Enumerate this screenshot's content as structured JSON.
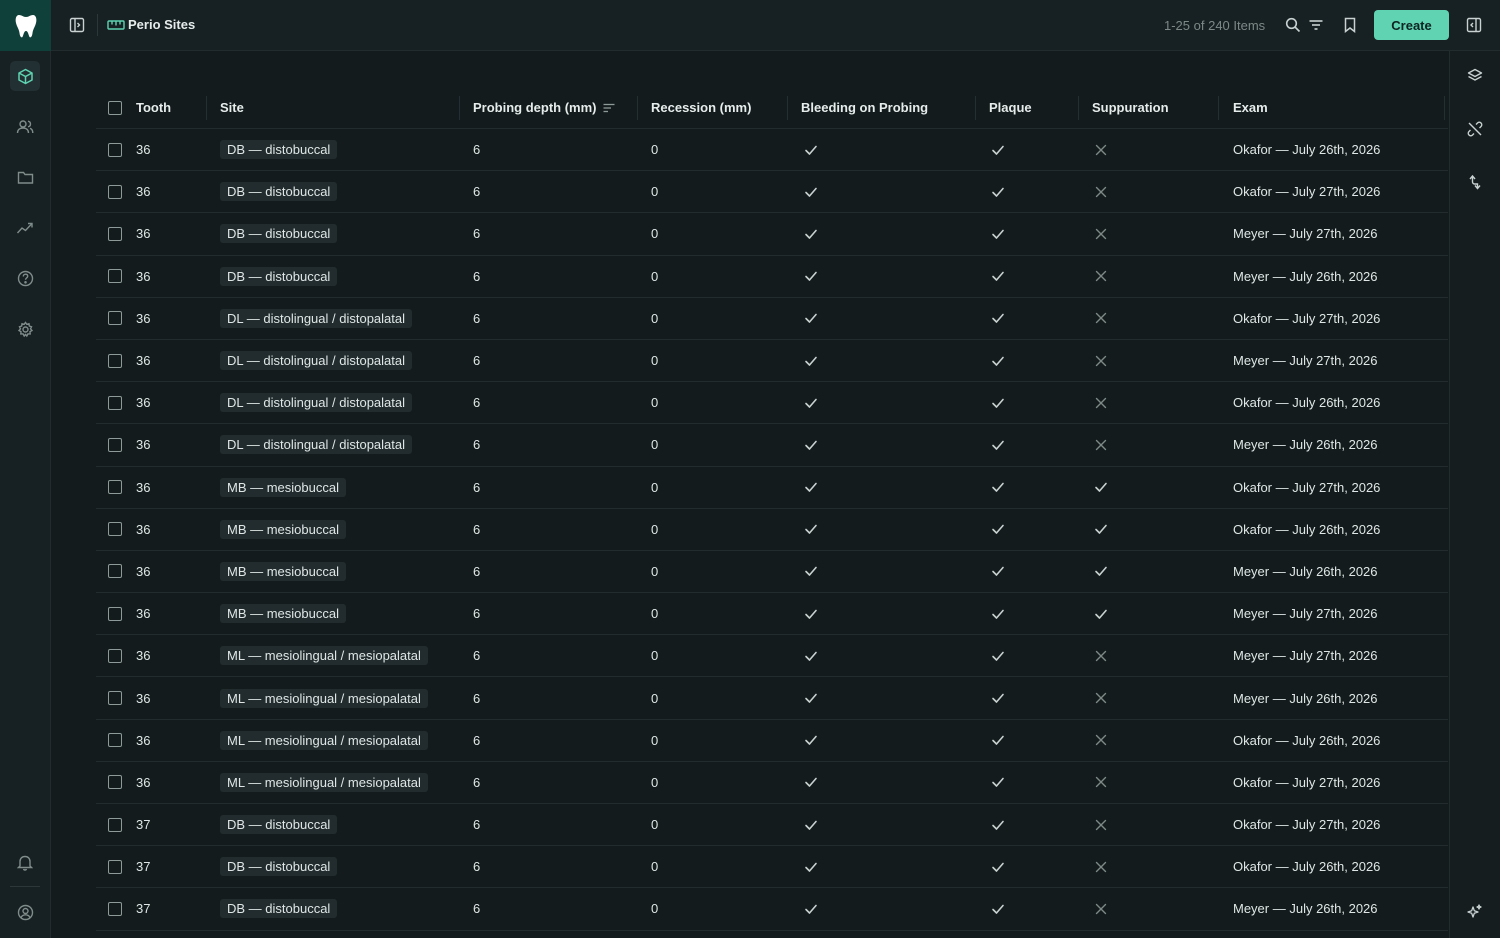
{
  "app": {
    "title": "Perio Sites",
    "items_count": "1-25 of 240 Items",
    "create_label": "Create"
  },
  "columns": {
    "tooth": "Tooth",
    "site": "Site",
    "probing": "Probing depth (mm)",
    "recession": "Recession (mm)",
    "bleeding": "Bleeding on Probing",
    "plaque": "Plaque",
    "suppuration": "Suppuration",
    "exam": "Exam"
  },
  "rows": [
    {
      "tooth": "36",
      "site": "DB — distobuccal",
      "probing": "6",
      "recession": "0",
      "bleeding": true,
      "plaque": true,
      "suppuration": false,
      "exam": "Okafor — July 26th, 2026"
    },
    {
      "tooth": "36",
      "site": "DB — distobuccal",
      "probing": "6",
      "recession": "0",
      "bleeding": true,
      "plaque": true,
      "suppuration": false,
      "exam": "Okafor — July 27th, 2026"
    },
    {
      "tooth": "36",
      "site": "DB — distobuccal",
      "probing": "6",
      "recession": "0",
      "bleeding": true,
      "plaque": true,
      "suppuration": false,
      "exam": "Meyer — July 27th, 2026"
    },
    {
      "tooth": "36",
      "site": "DB — distobuccal",
      "probing": "6",
      "recession": "0",
      "bleeding": true,
      "plaque": true,
      "suppuration": false,
      "exam": "Meyer — July 26th, 2026"
    },
    {
      "tooth": "36",
      "site": "DL — distolingual / distopalatal",
      "probing": "6",
      "recession": "0",
      "bleeding": true,
      "plaque": true,
      "suppuration": false,
      "exam": "Okafor — July 27th, 2026"
    },
    {
      "tooth": "36",
      "site": "DL — distolingual / distopalatal",
      "probing": "6",
      "recession": "0",
      "bleeding": true,
      "plaque": true,
      "suppuration": false,
      "exam": "Meyer — July 27th, 2026"
    },
    {
      "tooth": "36",
      "site": "DL — distolingual / distopalatal",
      "probing": "6",
      "recession": "0",
      "bleeding": true,
      "plaque": true,
      "suppuration": false,
      "exam": "Okafor — July 26th, 2026"
    },
    {
      "tooth": "36",
      "site": "DL — distolingual / distopalatal",
      "probing": "6",
      "recession": "0",
      "bleeding": true,
      "plaque": true,
      "suppuration": false,
      "exam": "Meyer — July 26th, 2026"
    },
    {
      "tooth": "36",
      "site": "MB — mesiobuccal",
      "probing": "6",
      "recession": "0",
      "bleeding": true,
      "plaque": true,
      "suppuration": true,
      "exam": "Okafor — July 27th, 2026"
    },
    {
      "tooth": "36",
      "site": "MB — mesiobuccal",
      "probing": "6",
      "recession": "0",
      "bleeding": true,
      "plaque": true,
      "suppuration": true,
      "exam": "Okafor — July 26th, 2026"
    },
    {
      "tooth": "36",
      "site": "MB — mesiobuccal",
      "probing": "6",
      "recession": "0",
      "bleeding": true,
      "plaque": true,
      "suppuration": true,
      "exam": "Meyer — July 26th, 2026"
    },
    {
      "tooth": "36",
      "site": "MB — mesiobuccal",
      "probing": "6",
      "recession": "0",
      "bleeding": true,
      "plaque": true,
      "suppuration": true,
      "exam": "Meyer — July 27th, 2026"
    },
    {
      "tooth": "36",
      "site": "ML — mesiolingual / mesiopalatal",
      "probing": "6",
      "recession": "0",
      "bleeding": true,
      "plaque": true,
      "suppuration": false,
      "exam": "Meyer — July 27th, 2026"
    },
    {
      "tooth": "36",
      "site": "ML — mesiolingual / mesiopalatal",
      "probing": "6",
      "recession": "0",
      "bleeding": true,
      "plaque": true,
      "suppuration": false,
      "exam": "Meyer — July 26th, 2026"
    },
    {
      "tooth": "36",
      "site": "ML — mesiolingual / mesiopalatal",
      "probing": "6",
      "recession": "0",
      "bleeding": true,
      "plaque": true,
      "suppuration": false,
      "exam": "Okafor — July 26th, 2026"
    },
    {
      "tooth": "36",
      "site": "ML — mesiolingual / mesiopalatal",
      "probing": "6",
      "recession": "0",
      "bleeding": true,
      "plaque": true,
      "suppuration": false,
      "exam": "Okafor — July 27th, 2026"
    },
    {
      "tooth": "37",
      "site": "DB — distobuccal",
      "probing": "6",
      "recession": "0",
      "bleeding": true,
      "plaque": true,
      "suppuration": false,
      "exam": "Okafor — July 27th, 2026"
    },
    {
      "tooth": "37",
      "site": "DB — distobuccal",
      "probing": "6",
      "recession": "0",
      "bleeding": true,
      "plaque": true,
      "suppuration": false,
      "exam": "Okafor — July 26th, 2026"
    },
    {
      "tooth": "37",
      "site": "DB — distobuccal",
      "probing": "6",
      "recession": "0",
      "bleeding": true,
      "plaque": true,
      "suppuration": false,
      "exam": "Meyer — July 26th, 2026"
    }
  ],
  "icons": {
    "sidebar": [
      "cube-icon",
      "users-icon",
      "folder-icon",
      "chart-line-icon",
      "help-circle-icon",
      "gear-icon",
      "bell-icon",
      "user-circle-icon"
    ],
    "rightrail": [
      "layers-icon",
      "unlink-icon",
      "swap-icon",
      "sparkle-icon"
    ]
  },
  "colors": {
    "accent": "#5fd3b2",
    "background": "#131b1c",
    "check": "#c9d2d1",
    "cross": "#7c8987"
  }
}
